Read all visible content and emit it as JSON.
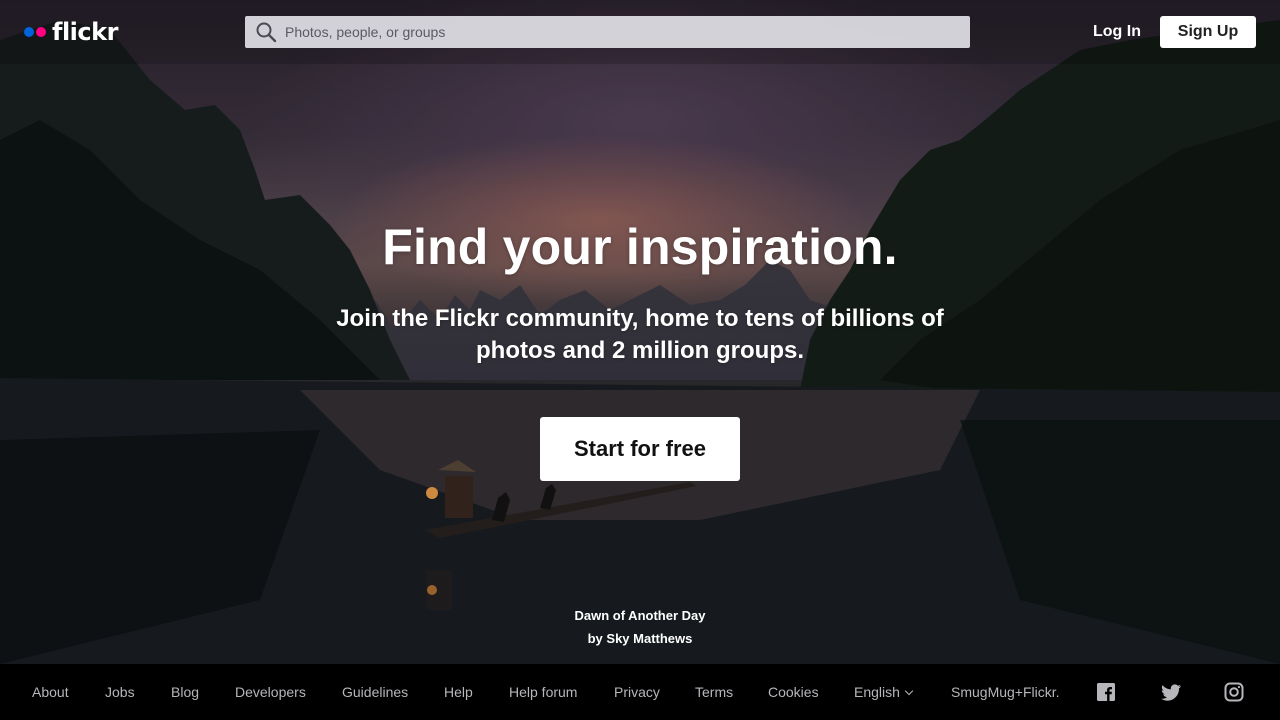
{
  "header": {
    "logo_text": "flickr",
    "search_placeholder": "Photos, people, or groups",
    "login_label": "Log In",
    "signup_label": "Sign Up"
  },
  "hero": {
    "title": "Find your inspiration.",
    "subtitle": "Join the Flickr community, home to tens of billions of photos and 2 million groups.",
    "cta_label": "Start for free",
    "photo_title": "Dawn of Another Day",
    "photo_credit": "by Sky Matthews"
  },
  "footer": {
    "links": [
      "About",
      "Jobs",
      "Blog",
      "Developers",
      "Guidelines",
      "Help",
      "Help forum",
      "Privacy",
      "Terms",
      "Cookies"
    ],
    "language": "English",
    "partner": "SmugMug+Flickr.",
    "social": [
      "facebook-icon",
      "twitter-icon",
      "instagram-icon"
    ]
  },
  "colors": {
    "brand_blue": "#0063dc",
    "brand_pink": "#ff0084",
    "footer_bg": "#000000",
    "footer_text": "#b6b6bb"
  }
}
